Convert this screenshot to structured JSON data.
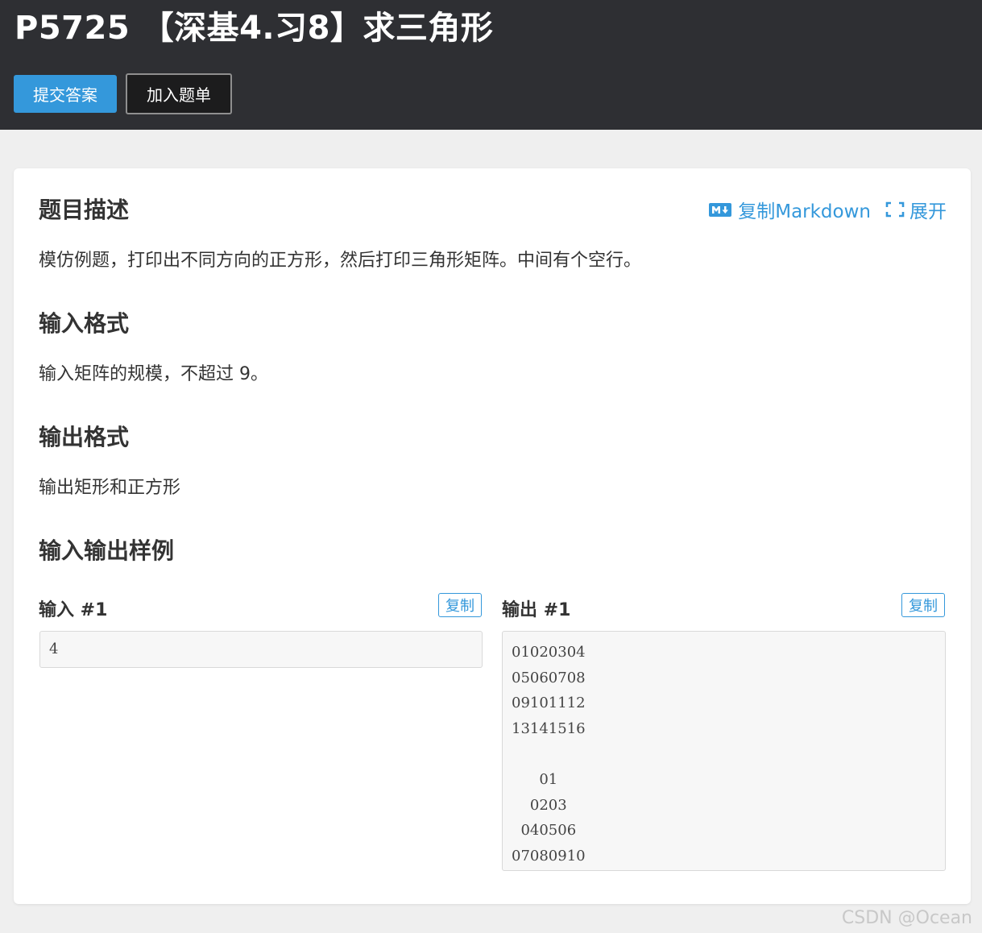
{
  "header": {
    "title": "P5725 【深基4.习8】求三角形",
    "buttons": {
      "submit": "提交答案",
      "add_to_list": "加入题单"
    }
  },
  "toolbar": {
    "copy_markdown": "复制Markdown",
    "expand": "展开",
    "markdown_icon": "markdown-icon",
    "expand_icon": "expand-icon"
  },
  "sections": {
    "description": {
      "heading": "题目描述",
      "text": "模仿例题，打印出不同方向的正方形，然后打印三角形矩阵。中间有个空行。"
    },
    "input_format": {
      "heading": "输入格式",
      "text": "输入矩阵的规模，不超过 9。"
    },
    "output_format": {
      "heading": "输出格式",
      "text": "输出矩形和正方形"
    },
    "samples": {
      "heading": "输入输出样例"
    }
  },
  "samples": {
    "input": {
      "label": "输入 #1",
      "copy": "复制",
      "content": "4"
    },
    "output": {
      "label": "输出 #1",
      "copy": "复制",
      "content": "01020304\n05060708\n09101112\n13141516\n\n      01\n    0203\n  040506\n07080910"
    }
  },
  "watermark": "CSDN @Ocean",
  "colors": {
    "accent": "#3498db",
    "header_bg": "#2e2f33",
    "page_bg": "#efefef"
  }
}
